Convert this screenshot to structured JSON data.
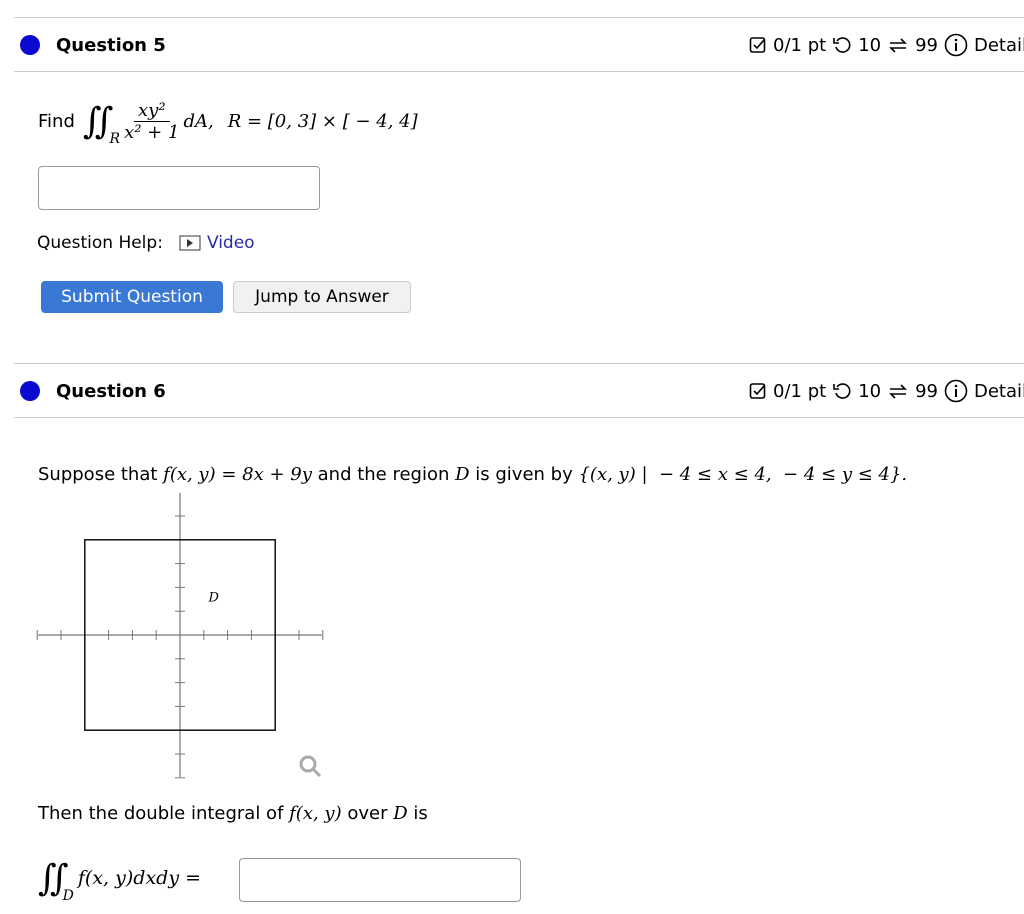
{
  "questions": [
    {
      "title": "Question 5",
      "score": "0/1 pt",
      "retries": "10",
      "attempts": "99",
      "details": "Details",
      "find": "Find",
      "integrand_num": "xy²",
      "integrand_den": "x² + 1",
      "dA": "dA,",
      "region": "R = [0, 3] × [ − 4, 4]",
      "sub_R": "R",
      "answer_value": "",
      "help_label": "Question Help:",
      "video_label": "Video",
      "submit": "Submit Question",
      "jump": "Jump to Answer"
    },
    {
      "title": "Question 6",
      "score": "0/1 pt",
      "retries": "10",
      "attempts": "99",
      "details": "Details",
      "stmt_a": "Suppose that ",
      "f": "f(x, y) = 8x + 9y",
      "stmt_b": " and the region ",
      "D": "D",
      "stmt_c": " is given by ",
      "set": "{(x, y) |  − 4 ≤ x ≤ 4,  − 4 ≤ y ≤ 4}.",
      "graph_label": "D",
      "then_a": "Then the double integral of ",
      "then_f": "f(x, y)",
      "then_b": " over ",
      "then_c": " is",
      "integral_expr": "f(x, y)dxdy =",
      "sub_D": "D",
      "answer_value": ""
    }
  ],
  "graph": {
    "x_range": [
      -6,
      6
    ],
    "y_range": [
      -6,
      5
    ],
    "region": {
      "x": [
        -4,
        4
      ],
      "y": [
        -4,
        4
      ]
    }
  },
  "colors": {
    "dot": "#0a0ad0",
    "submit": "#3a78d6",
    "link": "#2a2aa8"
  }
}
